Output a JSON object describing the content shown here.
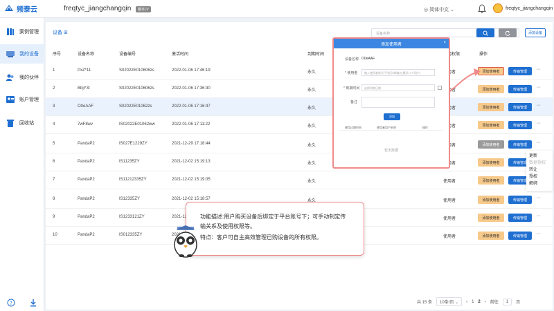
{
  "brand": {
    "name": "频泰云"
  },
  "topbar": {
    "workspace": "freqtyc_jiangchangqin",
    "badge": "版本LV",
    "language": "简体中文",
    "username": "freqtyc_jiangchangqin"
  },
  "sidebar": {
    "items": [
      {
        "label": "案例管理"
      },
      {
        "label": "我的设备"
      },
      {
        "label": "我的伙伴"
      },
      {
        "label": "账户管理"
      },
      {
        "label": "回收站"
      }
    ]
  },
  "main": {
    "tab": "设备",
    "search_placeholder": "设备名称",
    "add_device": "添加设备"
  },
  "table": {
    "headers": [
      "序号",
      "设备名称",
      "设备编号",
      "激活时间",
      "到期时间",
      "使用权限",
      "操作"
    ],
    "rows": [
      {
        "no": "1",
        "name": "PxZ*11",
        "code": "S02022E010606zs",
        "time": "2022-01-06 17:46:19",
        "expire": "永久",
        "perm": "使用者"
      },
      {
        "no": "2",
        "name": "BbjY3I",
        "code": "S02022E010606zs",
        "time": "2022-01-06 17:36:30",
        "expire": "永久",
        "perm": "使用者"
      },
      {
        "no": "3",
        "name": "O0eAAF",
        "code": "S02022E01062zs",
        "time": "2022-01-06 17:16:47",
        "expire": "永久",
        "perm": "使用者"
      },
      {
        "no": "4",
        "name": "7wF8wv",
        "code": "IS02022E01062ww",
        "time": "2022-01-06 17:11:22",
        "expire": "永久",
        "perm": "使用者"
      },
      {
        "no": "5",
        "name": "PandaP2",
        "code": "IS027E1229ZY",
        "time": "2021-12-29 17:18:44",
        "expire": "永久",
        "perm": "使用者"
      },
      {
        "no": "6",
        "name": "PandaP2",
        "code": "IS11235ZY",
        "time": "2021-12-02 15:19:13",
        "expire": "永久",
        "perm": "使用者"
      },
      {
        "no": "7",
        "name": "PandaP2",
        "code": "IS11212335ZY",
        "time": "2021-12-02 15:19:05",
        "expire": "永久",
        "perm": "使用者"
      },
      {
        "no": "8",
        "name": "PandaP2",
        "code": "IS12335ZY",
        "time": "2021-12-02 15:18:57",
        "expire": "永久",
        "perm": "使用者"
      },
      {
        "no": "9",
        "name": "PandaP2",
        "code": "IS1233121ZY",
        "time": "2021-12-02 15:18:48",
        "expire": "永久",
        "perm": "使用者"
      },
      {
        "no": "10",
        "name": "PandaP2",
        "code": "IS012335ZY",
        "time": "2021-12-02 15:18:39",
        "expire": "永久",
        "perm": "使用者"
      }
    ],
    "btn_add_user": "添加使用者",
    "btn_transfer": "传输管理",
    "more": "···"
  },
  "context_menu": {
    "items": [
      "更新",
      "数据授权",
      "转让",
      "授权",
      "解绑"
    ]
  },
  "pager": {
    "total": "共 15 条",
    "size": "10条/页",
    "page1": "1",
    "page2": "2",
    "goto": "前往",
    "input": "1",
    "unit": "页"
  },
  "dialog": {
    "title": "添加使用者",
    "device_label": "设备名称",
    "device_value": "O0eAAF",
    "user_label": "* 使用者",
    "user_placeholder": "输入使用者账号/手机号/邮箱名(最多10个用户)",
    "expire_label": "* 到期时间",
    "expire_placeholder": "选择到期日期",
    "remark_label": "备注",
    "submit": "添加",
    "col1": "使用过期时间",
    "col2": "使用者用户名称",
    "col3": "操作",
    "empty": "暂无数据"
  },
  "callout": {
    "line1": "功能描述:用户购买设备后绑定于平台账号下；可手动制定传",
    "line2": "输关系及使用权限等。",
    "line3": "特点：客户可自主高效管理已购设备的所有权限。"
  }
}
